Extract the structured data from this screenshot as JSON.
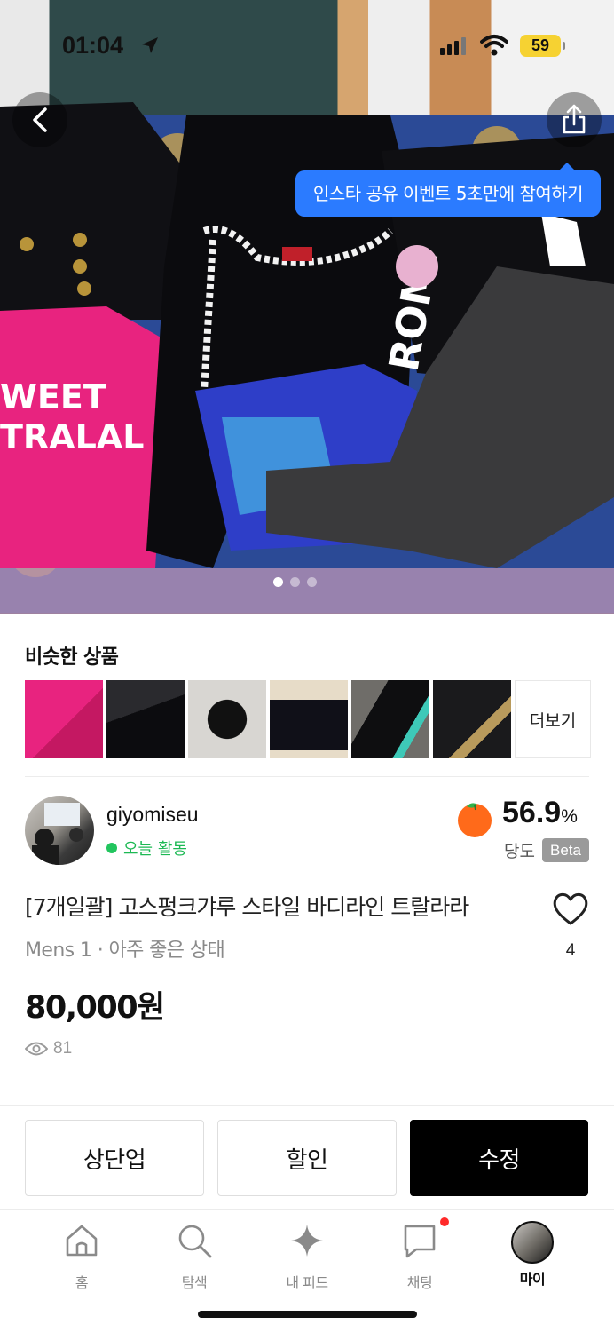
{
  "status_bar": {
    "time": "01:04",
    "battery": "59"
  },
  "hero": {
    "tooltip": "인스타 공유 이벤트 5초만에 참여하기",
    "image_count": 3,
    "current_index": 1
  },
  "similar": {
    "title": "비슷한 상품",
    "thumbnails": [
      "thumb-1",
      "thumb-2",
      "thumb-3",
      "thumb-4",
      "thumb-5",
      "thumb-6"
    ],
    "more_label": "더보기"
  },
  "seller": {
    "name": "giyomiseu",
    "activity": "오늘 활동",
    "score_value": "56.9",
    "score_unit": "%",
    "score_label": "당도",
    "score_badge": "Beta"
  },
  "product": {
    "title": "[7개일괄] 고스펑크갸루 스타일 바디라인 트랄라라",
    "subtitle": "Mens 1 · 아주 좋은 상태",
    "like_count": "4",
    "price": "80,000원",
    "views": "81"
  },
  "actions": {
    "bump": "상단업",
    "discount": "할인",
    "edit": "수정"
  },
  "tabs": [
    {
      "label": "홈",
      "icon": "home-icon"
    },
    {
      "label": "탐색",
      "icon": "search-icon"
    },
    {
      "label": "내 피드",
      "icon": "sparkle-icon"
    },
    {
      "label": "채팅",
      "icon": "chat-icon"
    },
    {
      "label": "마이",
      "icon": "profile-avatar"
    }
  ],
  "colors": {
    "accent_blue": "#2b7bff",
    "online_green": "#22c55e",
    "primary_black": "#000000",
    "notification_red": "#ff2a2a"
  }
}
